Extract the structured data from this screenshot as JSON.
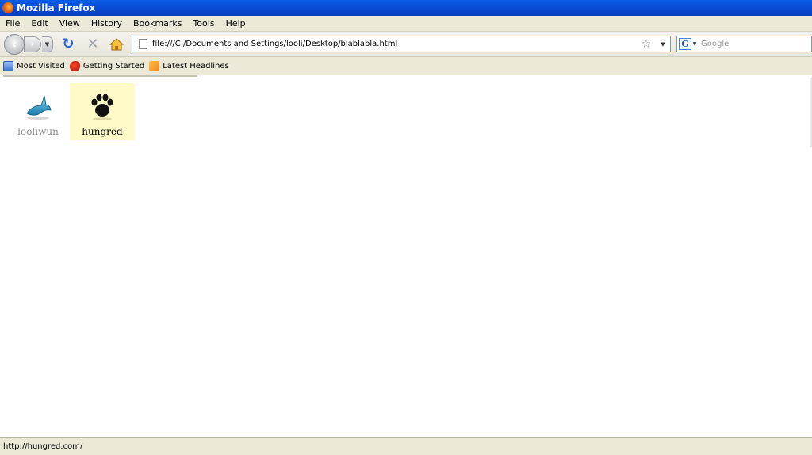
{
  "window": {
    "title": "Mozilla Firefox"
  },
  "menubar": {
    "items": [
      {
        "label": "File"
      },
      {
        "label": "Edit"
      },
      {
        "label": "View"
      },
      {
        "label": "History"
      },
      {
        "label": "Bookmarks"
      },
      {
        "label": "Tools"
      },
      {
        "label": "Help"
      }
    ]
  },
  "navbar": {
    "url": "file:///C:/Documents and Settings/looli/Desktop/blablabla.html",
    "search_placeholder": "Google",
    "search_engine_letter": "G",
    "icons": [
      "back-icon",
      "forward-icon",
      "reload-icon",
      "stop-icon",
      "home-icon",
      "bookmark-star-icon"
    ]
  },
  "bookmarks": {
    "items": [
      {
        "label": "Most Visited",
        "icon": "most-visited-icon"
      },
      {
        "label": "Getting Started",
        "icon": "firefox-start-icon"
      },
      {
        "label": "Latest Headlines",
        "icon": "rss-feed-icon"
      }
    ]
  },
  "content": {
    "tiles": [
      {
        "label": "looliwun",
        "icon": "dolphin-icon",
        "selected": false
      },
      {
        "label": "hungred",
        "icon": "paw-print-icon",
        "selected": true
      }
    ]
  },
  "statusbar": {
    "text": "http://hungred.com/"
  },
  "colors": {
    "titlebar": "#0a4ed6",
    "chrome": "#ece9d8",
    "selected_tile_bg": "#fffac8",
    "dolphin": "#2aa0c8"
  }
}
